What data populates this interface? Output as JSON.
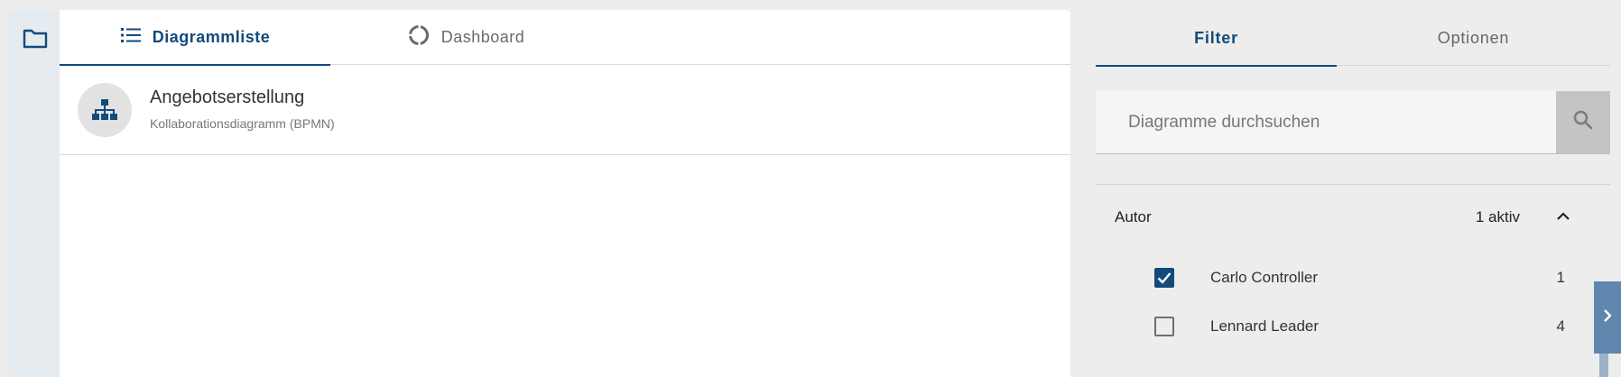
{
  "main_tabs": [
    {
      "label": "Diagrammliste",
      "icon": "list-icon",
      "active": true
    },
    {
      "label": "Dashboard",
      "icon": "donut-chart-icon",
      "active": false
    }
  ],
  "diagrams": [
    {
      "title": "Angebotserstellung",
      "type": "Kollaborationsdiagramm (BPMN)",
      "icon": "org-chart-icon"
    }
  ],
  "panel": {
    "tabs": [
      {
        "label": "Filter",
        "active": true
      },
      {
        "label": "Optionen",
        "active": false
      }
    ],
    "search": {
      "placeholder": "Diagramme durchsuchen",
      "value": ""
    },
    "author_section": {
      "title": "Autor",
      "active_count": "1 aktiv",
      "options": [
        {
          "name": "Carlo Controller",
          "count": "1",
          "checked": true
        },
        {
          "name": "Lennard Leader",
          "count": "4",
          "checked": false
        }
      ]
    }
  },
  "colors": {
    "accent": "#134a7c",
    "background": "#ededed",
    "rail": "#e6ebf0",
    "edge_tab": "#5f87ad"
  }
}
